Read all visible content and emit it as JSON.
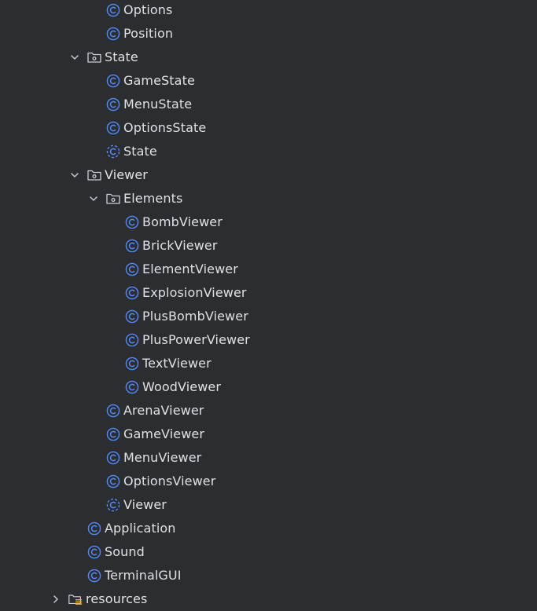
{
  "project_tree": {
    "rows": [
      {
        "label": "Options",
        "kind": "class-icon",
        "depth": 3,
        "expanded": null
      },
      {
        "label": "Position",
        "kind": "class-icon",
        "depth": 3,
        "expanded": null
      },
      {
        "label": "State",
        "kind": "package-icon",
        "depth": 2,
        "expanded": true
      },
      {
        "label": "GameState",
        "kind": "class-icon",
        "depth": 3,
        "expanded": null
      },
      {
        "label": "MenuState",
        "kind": "class-icon",
        "depth": 3,
        "expanded": null
      },
      {
        "label": "OptionsState",
        "kind": "class-icon",
        "depth": 3,
        "expanded": null
      },
      {
        "label": "State",
        "kind": "abstract-class-icon",
        "depth": 3,
        "expanded": null
      },
      {
        "label": "Viewer",
        "kind": "package-icon",
        "depth": 2,
        "expanded": true
      },
      {
        "label": "Elements",
        "kind": "package-icon",
        "depth": 3,
        "expanded": true
      },
      {
        "label": "BombViewer",
        "kind": "class-icon",
        "depth": 4,
        "expanded": null
      },
      {
        "label": "BrickViewer",
        "kind": "class-icon",
        "depth": 4,
        "expanded": null
      },
      {
        "label": "ElementViewer",
        "kind": "class-icon",
        "depth": 4,
        "expanded": null
      },
      {
        "label": "ExplosionViewer",
        "kind": "class-icon",
        "depth": 4,
        "expanded": null
      },
      {
        "label": "PlusBombViewer",
        "kind": "class-icon",
        "depth": 4,
        "expanded": null
      },
      {
        "label": "PlusPowerViewer",
        "kind": "class-icon",
        "depth": 4,
        "expanded": null
      },
      {
        "label": "TextViewer",
        "kind": "class-icon",
        "depth": 4,
        "expanded": null
      },
      {
        "label": "WoodViewer",
        "kind": "class-icon",
        "depth": 4,
        "expanded": null
      },
      {
        "label": "ArenaViewer",
        "kind": "class-icon",
        "depth": 3,
        "expanded": null
      },
      {
        "label": "GameViewer",
        "kind": "class-icon",
        "depth": 3,
        "expanded": null
      },
      {
        "label": "MenuViewer",
        "kind": "class-icon",
        "depth": 3,
        "expanded": null
      },
      {
        "label": "OptionsViewer",
        "kind": "class-icon",
        "depth": 3,
        "expanded": null
      },
      {
        "label": "Viewer",
        "kind": "abstract-class-icon",
        "depth": 3,
        "expanded": null
      },
      {
        "label": "Application",
        "kind": "class-icon",
        "depth": 2,
        "expanded": null
      },
      {
        "label": "Sound",
        "kind": "class-icon",
        "depth": 2,
        "expanded": null
      },
      {
        "label": "TerminalGUI",
        "kind": "class-icon",
        "depth": 2,
        "expanded": null
      },
      {
        "label": "resources",
        "kind": "resources-folder-icon",
        "depth": 1,
        "expanded": false
      }
    ]
  },
  "colors": {
    "background": "#2b2d30",
    "text": "#dfe1e5",
    "class_icon": "#548af7",
    "folder_icon": "#ced0d6",
    "chevron": "#ced0d6",
    "resources_accent": "#e0a94a"
  }
}
